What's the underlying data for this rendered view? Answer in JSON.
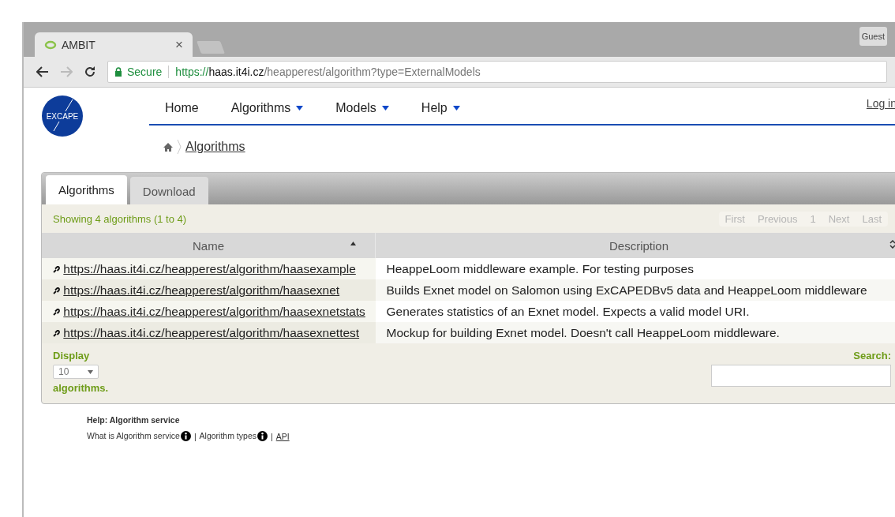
{
  "browser": {
    "tab": {
      "title": "AMBIT",
      "close": "×"
    },
    "profile": "Guest",
    "forward_disabled": true,
    "address": {
      "secure_label": "Secure",
      "scheme": "https://",
      "host": "haas.it4i.cz",
      "path": "/heapperest/algorithm?type=ExternalModels"
    }
  },
  "site": {
    "logo_text": "EXCAPE",
    "login": "Log in",
    "nav": [
      {
        "label": "Home",
        "dropdown": false
      },
      {
        "label": "Algorithms",
        "dropdown": true
      },
      {
        "label": "Models",
        "dropdown": true
      },
      {
        "label": "Help",
        "dropdown": true
      }
    ],
    "breadcrumb": "Algorithms"
  },
  "tabs": [
    {
      "label": "Algorithms",
      "selected": true
    },
    {
      "label": "Download",
      "selected": false
    }
  ],
  "table": {
    "info": "Showing 4 algorithms (1 to 4)",
    "pager": [
      {
        "label": "First",
        "disabled": true
      },
      {
        "label": "Previous",
        "disabled": true
      },
      {
        "label": "1",
        "disabled": true
      },
      {
        "label": "Next",
        "disabled": true
      },
      {
        "label": "Last",
        "disabled": true
      }
    ],
    "columns": [
      {
        "label": "Name",
        "sorted": true
      },
      {
        "label": "Description",
        "sorted": false
      }
    ],
    "rows": [
      {
        "name": "https://haas.it4i.cz/heapperest/algorithm/haasexample",
        "description": "HeappeLoom middleware example. For testing purposes"
      },
      {
        "name": "https://haas.it4i.cz/heapperest/algorithm/haasexnet",
        "description": "Builds Exnet model on Salomon using ExCAPEDBv5 data and HeappeLoom middleware"
      },
      {
        "name": "https://haas.it4i.cz/heapperest/algorithm/haasexnetstats",
        "description": "Generates statistics of an Exnet model. Expects a valid model URI."
      },
      {
        "name": "https://haas.it4i.cz/heapperest/algorithm/haasexnettest",
        "description": "Mockup for building Exnet model. Doesn't call HeappeLoom middleware."
      }
    ],
    "length": {
      "before": "Display",
      "value": "10",
      "after": "algorithms."
    },
    "search_label": "Search:"
  },
  "help": {
    "title": "Help: Algorithm service",
    "items": [
      {
        "kind": "info",
        "text": "What is Algorithm service"
      },
      {
        "kind": "separator",
        "text": "|"
      },
      {
        "kind": "info",
        "text": "Algorithm types"
      },
      {
        "kind": "separator",
        "text": "|"
      },
      {
        "kind": "link",
        "text": "API"
      }
    ]
  }
}
